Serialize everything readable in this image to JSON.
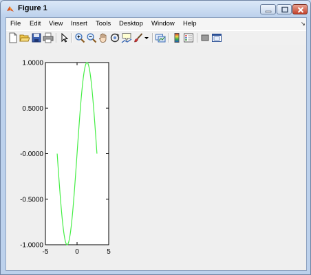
{
  "window": {
    "title": "Figure 1"
  },
  "menu": [
    "File",
    "Edit",
    "View",
    "Insert",
    "Tools",
    "Desktop",
    "Window",
    "Help"
  ],
  "menu_overflow_icon": "arrow-icon",
  "toolbar": [
    "new-figure-icon",
    "open-file-icon",
    "save-icon",
    "print-icon",
    "edit-plot-arrow-icon",
    "zoom-in-icon",
    "zoom-out-icon",
    "pan-hand-icon",
    "rotate-3d-icon",
    "data-cursor-icon",
    "brush-icon",
    "brush-dropdown-icon",
    "link-plot-icon",
    "insert-colorbar-icon",
    "insert-legend-icon",
    "hide-plot-tools-icon",
    "show-plot-tools-icon"
  ],
  "colors": {
    "line": "#44ee44",
    "axes_bg": "#ffffff",
    "figure_bg": "#efefef"
  },
  "chart_data": {
    "type": "line",
    "title": "",
    "xlabel": "",
    "ylabel": "",
    "xlim": [
      -5,
      5
    ],
    "ylim": [
      -1,
      1
    ],
    "xticks": [
      -5,
      0,
      5
    ],
    "xtick_labels": [
      "-5",
      "0",
      "5"
    ],
    "yticks": [
      -1,
      -0.5,
      0,
      0.5,
      1
    ],
    "ytick_labels": [
      "-1.0000",
      "-0.5000",
      "-0.0000",
      "0.5000",
      "1.0000"
    ],
    "grid": false,
    "series": [
      {
        "color": "#44ee44",
        "function": "sin(x)",
        "x_range": [
          -3.1416,
          3.1416
        ]
      }
    ]
  }
}
